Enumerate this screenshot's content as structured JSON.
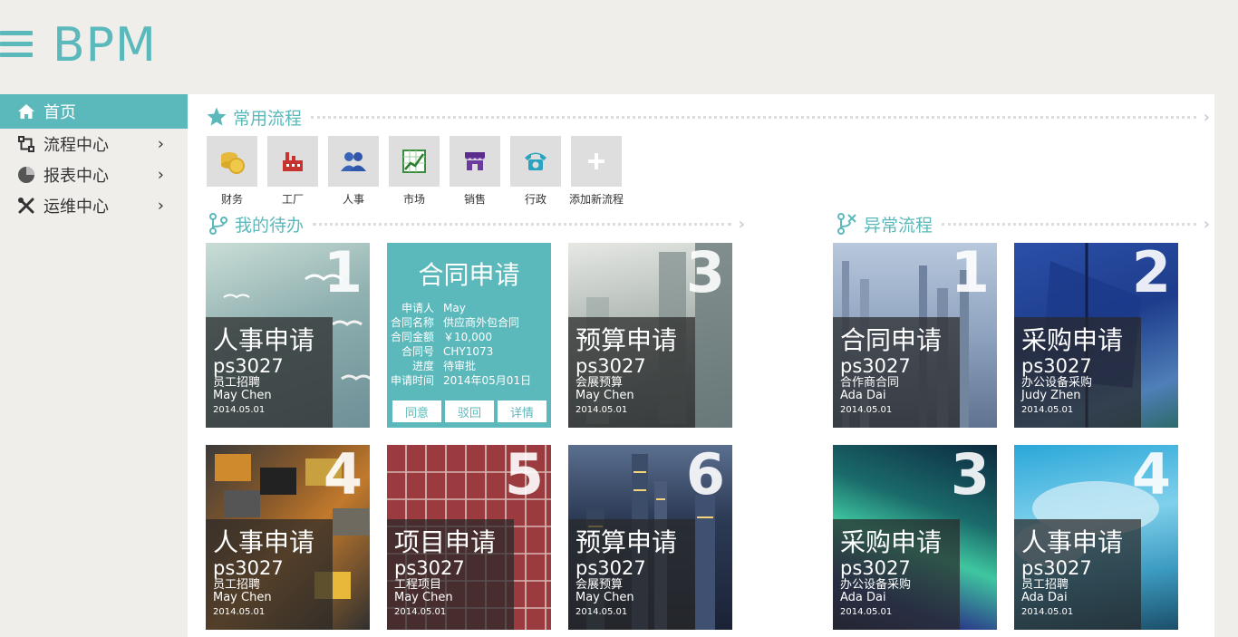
{
  "header": {
    "brand": "BPM"
  },
  "sidebar": {
    "items": [
      {
        "label": "首页"
      },
      {
        "label": "流程中心"
      },
      {
        "label": "报表中心"
      },
      {
        "label": "运维中心"
      }
    ]
  },
  "quick_flows": {
    "title": "常用流程",
    "items": [
      {
        "label": "财务",
        "icon": "coins-icon"
      },
      {
        "label": "工厂",
        "icon": "factory-icon"
      },
      {
        "label": "人事",
        "icon": "people-icon"
      },
      {
        "label": "市场",
        "icon": "market-chart-icon"
      },
      {
        "label": "销售",
        "icon": "store-icon"
      },
      {
        "label": "行政",
        "icon": "telephone-icon"
      },
      {
        "label": "添加新流程",
        "icon": "plus-icon"
      }
    ]
  },
  "my_todo": {
    "title": "我的待办",
    "tiles": [
      {
        "num": "1",
        "title": "人事申请",
        "code": "ps3027",
        "desc": "员工招聘",
        "user": "May Chen",
        "date": "2014.05.01"
      },
      {
        "num": "3",
        "title": "预算申请",
        "code": "ps3027",
        "desc": "会展预算",
        "user": "May Chen",
        "date": "2014.05.01"
      },
      {
        "num": "4",
        "title": "人事申请",
        "code": "ps3027",
        "desc": "员工招聘",
        "user": "May Chen",
        "date": "2014.05.01"
      },
      {
        "num": "5",
        "title": "项目申请",
        "code": "ps3027",
        "desc": "工程项目",
        "user": "May Chen",
        "date": "2014.05.01"
      },
      {
        "num": "6",
        "title": "预算申请",
        "code": "ps3027",
        "desc": "会展预算",
        "user": "May Chen",
        "date": "2014.05.01"
      }
    ],
    "detail": {
      "title": "合同申请",
      "rows": [
        {
          "k": "申请人",
          "v": "May"
        },
        {
          "k": "合同名称",
          "v": "供应商外包合同"
        },
        {
          "k": "合同金额",
          "v": "￥10,000"
        },
        {
          "k": "合同号",
          "v": "CHY1073"
        },
        {
          "k": "进度",
          "v": "待审批"
        },
        {
          "k": "申请时间",
          "v": "2014年05月01日"
        }
      ],
      "buttons": {
        "agree": "同意",
        "reject": "驳回",
        "details": "详情"
      }
    }
  },
  "exceptions": {
    "title": "异常流程",
    "tiles": [
      {
        "num": "1",
        "title": "合同申请",
        "code": "ps3027",
        "desc": "合作商合同",
        "user": "Ada Dai",
        "date": "2014.05.01"
      },
      {
        "num": "2",
        "title": "采购申请",
        "code": "ps3027",
        "desc": "办公设备采购",
        "user": "Judy Zhen",
        "date": "2014.05.01"
      },
      {
        "num": "3",
        "title": "采购申请",
        "code": "ps3027",
        "desc": "办公设备采购",
        "user": "Ada Dai",
        "date": "2014.05.01"
      },
      {
        "num": "4",
        "title": "人事申请",
        "code": "ps3027",
        "desc": "员工招聘",
        "user": "Ada Dai",
        "date": "2014.05.01"
      }
    ]
  },
  "colors": {
    "accent": "#5bb8bb",
    "background": "#efeeea",
    "panel": "#ffffff"
  }
}
